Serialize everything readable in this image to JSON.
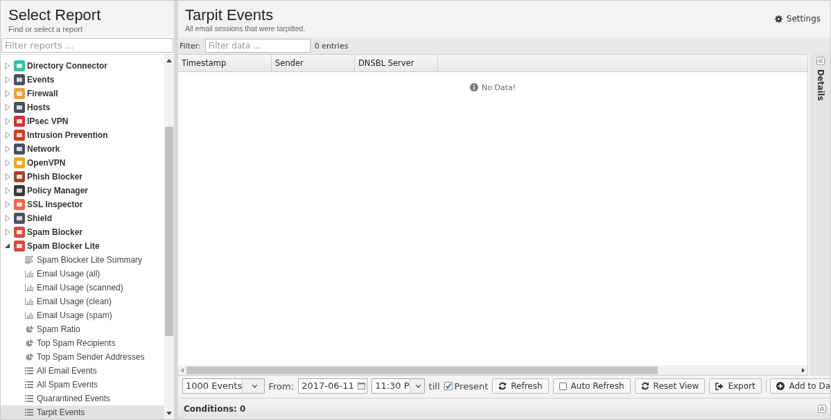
{
  "sidebar": {
    "title": "Select Report",
    "subtitle": "Find or select a report",
    "filter": {
      "placeholder": "Filter reports ..."
    },
    "categories": [
      {
        "label": "Directory Connector",
        "color": "#2fc6a4",
        "expanded": false
      },
      {
        "label": "Events",
        "color": "#4a5060",
        "expanded": false
      },
      {
        "label": "Firewall",
        "color": "#f0a030",
        "expanded": false
      },
      {
        "label": "Hosts",
        "color": "#4a5060",
        "expanded": false
      },
      {
        "label": "IPsec VPN",
        "color": "#d8303a",
        "expanded": false
      },
      {
        "label": "Intrusion Prevention",
        "color": "#d43a22",
        "expanded": false
      },
      {
        "label": "Network",
        "color": "#4a5060",
        "expanded": false
      },
      {
        "label": "OpenVPN",
        "color": "#f2a81c",
        "expanded": false
      },
      {
        "label": "Phish Blocker",
        "color": "#a0482a",
        "expanded": false
      },
      {
        "label": "Policy Manager",
        "color": "#3a3a3a",
        "expanded": false
      },
      {
        "label": "SSL Inspector",
        "color": "#f26444",
        "expanded": false
      },
      {
        "label": "Shield",
        "color": "#4a5060",
        "expanded": false
      },
      {
        "label": "Spam Blocker",
        "color": "#d84a42",
        "expanded": false
      },
      {
        "label": "Spam Blocker Lite",
        "color": "#d84a42",
        "expanded": true,
        "children": [
          {
            "label": "Spam Blocker Lite Summary",
            "kind": "text",
            "selected": false
          },
          {
            "label": "Email Usage (all)",
            "kind": "bar",
            "selected": false
          },
          {
            "label": "Email Usage (scanned)",
            "kind": "bar",
            "selected": false
          },
          {
            "label": "Email Usage (clean)",
            "kind": "bar",
            "selected": false
          },
          {
            "label": "Email Usage (spam)",
            "kind": "bar",
            "selected": false
          },
          {
            "label": "Spam Ratio",
            "kind": "pie",
            "selected": false
          },
          {
            "label": "Top Spam Recipients",
            "kind": "pie",
            "selected": false
          },
          {
            "label": "Top Spam Sender Addresses",
            "kind": "pie",
            "selected": false
          },
          {
            "label": "All Email Events",
            "kind": "list",
            "selected": false
          },
          {
            "label": "All Spam Events",
            "kind": "list",
            "selected": false
          },
          {
            "label": "Quarantined Events",
            "kind": "list",
            "selected": false
          },
          {
            "label": "Tarpit Events",
            "kind": "list",
            "selected": true
          }
        ]
      }
    ]
  },
  "report": {
    "title": "Tarpit Events",
    "subtitle": "All email sessions that were tarpitted.",
    "settings": "Settings",
    "filter": {
      "label": "Filter:",
      "placeholder": "Filter data ...",
      "count": "0 entries"
    },
    "table": {
      "columns": [
        "Timestamp",
        "Sender",
        "DNSBL Server"
      ],
      "empty": "No Data!"
    },
    "details": "Details"
  },
  "toolbar": {
    "limit": "1000 Events",
    "from_label": "From:",
    "date": "2017-06-11",
    "time": "11:30 P",
    "till_label": "till",
    "present": {
      "label": "Present",
      "checked": true
    },
    "buttons": [
      {
        "label": "Refresh",
        "kind": "refresh"
      },
      {
        "label": "Auto Refresh",
        "kind": "toggle",
        "checked": false
      },
      {
        "label": "Reset View",
        "kind": "refresh"
      },
      {
        "label": "Export",
        "kind": "export"
      },
      {
        "label": "Add to Da",
        "kind": "add"
      }
    ]
  },
  "conditions": "Conditions: 0"
}
